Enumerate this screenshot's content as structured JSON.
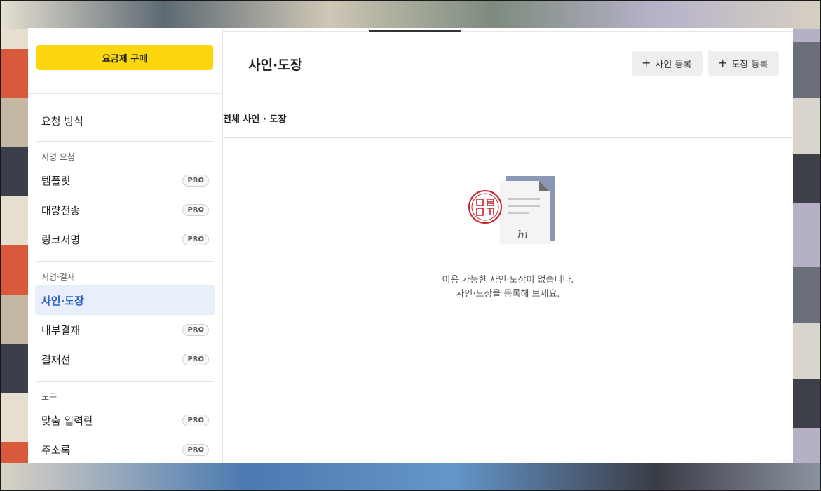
{
  "sidebar": {
    "buy_button": "요금제 구매",
    "request_method": "요청 방식",
    "pro_badge": "PRO",
    "sections": [
      {
        "label": "서명 요청",
        "items": [
          {
            "label": "템플릿",
            "pro": true
          },
          {
            "label": "대량전송",
            "pro": true
          },
          {
            "label": "링크서명",
            "pro": true
          }
        ]
      },
      {
        "label": "서명·결재",
        "items": [
          {
            "label": "사인·도장",
            "pro": false,
            "active": true
          },
          {
            "label": "내부결재",
            "pro": true
          },
          {
            "label": "결재선",
            "pro": true
          }
        ]
      },
      {
        "label": "도구",
        "items": [
          {
            "label": "맞춤 입력란",
            "pro": true
          },
          {
            "label": "주소록",
            "pro": true
          }
        ]
      }
    ]
  },
  "main": {
    "title": "사인·도장",
    "add_sign_button": "사인 등록",
    "add_stamp_button": "도장 등록",
    "list_header": "전체 사인 · 도장",
    "empty_line1": "이용 가능한 사인·도장이 없습니다.",
    "empty_line2": "사인·도장을 등록해 보세요.",
    "illustration_signature": "hi"
  },
  "colors": {
    "accent_yellow": "#fcd60f",
    "active_bg": "#e8eefa",
    "active_text": "#2a63c9",
    "stamp_red": "#c8242b",
    "doc_back": "#8a98b5"
  },
  "icons": {
    "plus": "plus-icon",
    "empty_state": "stamp-document-illustration"
  }
}
